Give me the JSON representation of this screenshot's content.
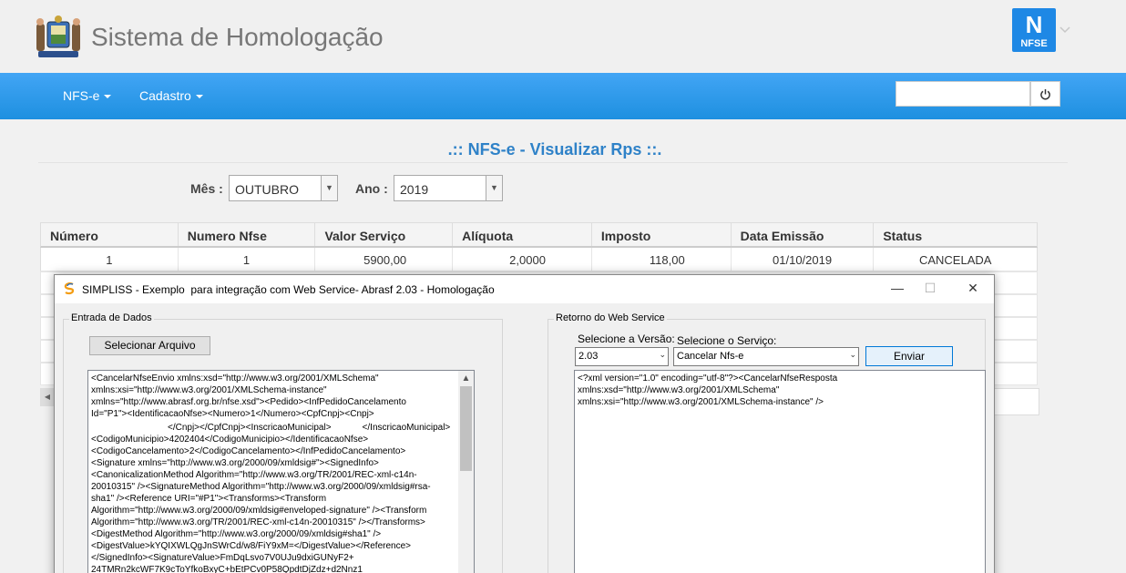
{
  "app": {
    "title": "Sistema de Homologação",
    "badge_big": "N",
    "badge_small": "NFSE"
  },
  "nav": {
    "items": [
      {
        "label": "NFS-e"
      },
      {
        "label": "Cadastro"
      }
    ],
    "power_icon": "⏻"
  },
  "page": {
    "title": ".:: NFS-e - Visualizar Rps ::.",
    "mes_label": "Mês :",
    "mes_value": "OUTUBRO",
    "ano_label": "Ano :",
    "ano_value": "2019"
  },
  "grid": {
    "headers": [
      "Número",
      "Numero Nfse",
      "Valor Serviço",
      "Alíquota",
      "Imposto",
      "Data Emissão",
      "Status"
    ],
    "rows": [
      [
        "1",
        "1",
        "5900,00",
        "2,0000",
        "118,00",
        "01/10/2019",
        "CANCELADA"
      ]
    ]
  },
  "window": {
    "title": "SIMPLISS - Exemplo  para integração com Web Service- Abrasf 2.03 - Homologação",
    "minimize": "—",
    "maximize": "☐",
    "close": "✕",
    "entrada": {
      "label": "Entrada de Dados",
      "select_file_button": "Selecionar Arquivo",
      "xml_lines": [
        "<CancelarNfseEnvio xmlns:xsd=\"http://www.w3.org/2001/XMLSchema\"",
        "xmlns:xsi=\"http://www.w3.org/2001/XMLSchema-instance\"",
        "xmlns=\"http://www.abrasf.org.br/nfse.xsd\"><Pedido><InfPedidoCancelamento",
        "Id=\"P1\"><IdentificacaoNfse><Numero>1</Numero><CpfCnpj><Cnpj>",
        "</Cnpj></CpfCnpj><InscricaoMunicipal>",
        "</InscricaoMunicipal>",
        "<CodigoMunicipio>4202404</CodigoMunicipio></IdentificacaoNfse>",
        "<CodigoCancelamento>2</CodigoCancelamento></InfPedidoCancelamento>",
        "<Signature xmlns=\"http://www.w3.org/2000/09/xmldsig#\"><SignedInfo>",
        "<CanonicalizationMethod Algorithm=\"http://www.w3.org/TR/2001/REC-xml-c14n-",
        "20010315\" /><SignatureMethod Algorithm=\"http://www.w3.org/2000/09/xmldsig#rsa-",
        "sha1\" /><Reference URI=\"#P1\"><Transforms><Transform",
        "Algorithm=\"http://www.w3.org/2000/09/xmldsig#enveloped-signature\" /><Transform",
        "Algorithm=\"http://www.w3.org/TR/2001/REC-xml-c14n-20010315\" /></Transforms>",
        "<DigestMethod Algorithm=\"http://www.w3.org/2000/09/xmldsig#sha1\" />",
        "<DigestValue>kYQIXWLQgJnSWrCd/w8/FiY9xM=</DigestValue></Reference>",
        "</SignedInfo><SignatureValue>FmDqLsvo7V0UJu9dxiGUNyF2+",
        "24TMRn2kcWF7K9cToYfkoBxyC+bEtPCv0P58QpdtDjZdz+d2Nnz1"
      ]
    },
    "retorno": {
      "label": "Retorno do Web Service",
      "versao_label": "Selecione a Versão:",
      "versao_value": "2.03",
      "servico_label": "Selecione o Serviço:",
      "servico_value": "Cancelar Nfs-e",
      "enviar_button": "Enviar",
      "xml_lines": [
        "<?xml version=\"1.0\" encoding=\"utf-8\"?><CancelarNfseResposta",
        "xmlns:xsd=\"http://www.w3.org/2001/XMLSchema\"",
        "xmlns:xsi=\"http://www.w3.org/2001/XMLSchema-instance\" />"
      ]
    }
  },
  "icons": {
    "logo": "coat-of-arms-icon",
    "dropdown": "chevron-down-icon",
    "power": "power-icon",
    "app": "simpliss-icon"
  },
  "colors": {
    "navbar": "#1e90e0",
    "title_blue": "#2f82c8",
    "badge": "#1e88e5"
  }
}
